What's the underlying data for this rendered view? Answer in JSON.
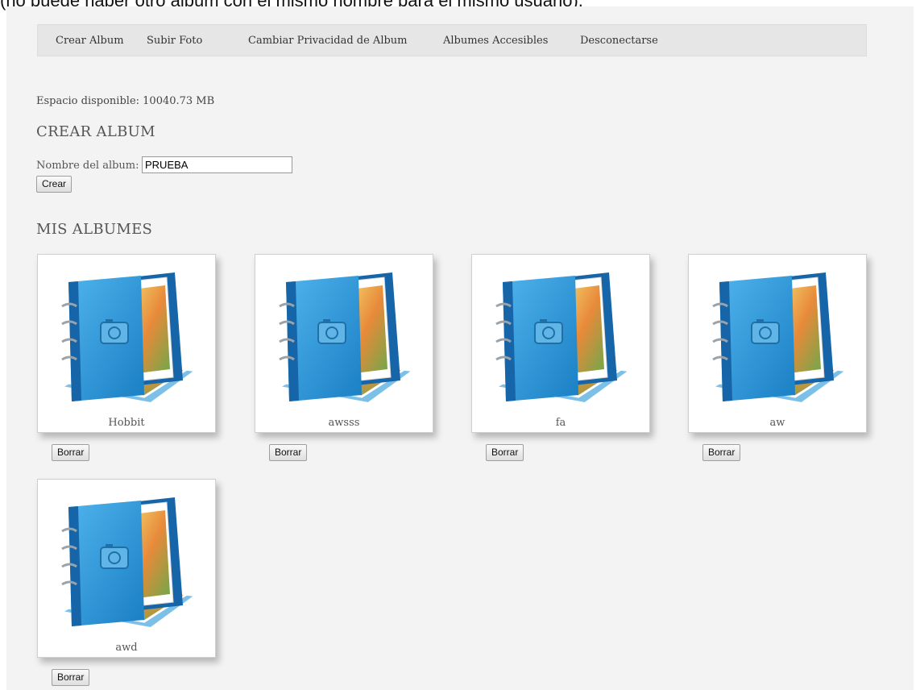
{
  "caption": "(no puede haber otro album con el mismo nombre para el mismo usuario).",
  "nav": {
    "items": [
      "Crear Album",
      "Subir Foto",
      "Cambiar Privacidad de Album",
      "Albumes Accesibles",
      "Desconectarse"
    ]
  },
  "space_text": "Espacio disponible: 10040.73 MB",
  "create": {
    "heading": "CREAR ALBUM",
    "label": "Nombre del album:",
    "input_value": "PRUEBA",
    "button": "Crear"
  },
  "albums": {
    "heading": "MIS ALBUMES",
    "icon": "photo-album-icon",
    "delete_label": "Borrar",
    "items": [
      {
        "name": "Hobbit"
      },
      {
        "name": "awsss"
      },
      {
        "name": "fa"
      },
      {
        "name": "aw"
      },
      {
        "name": "awd"
      }
    ]
  },
  "colors": {
    "album_blue": "#2196d6",
    "album_blue_dark": "#1565a8",
    "page_bg": "#f3f3f3",
    "nav_bg": "#e6e6e6"
  }
}
